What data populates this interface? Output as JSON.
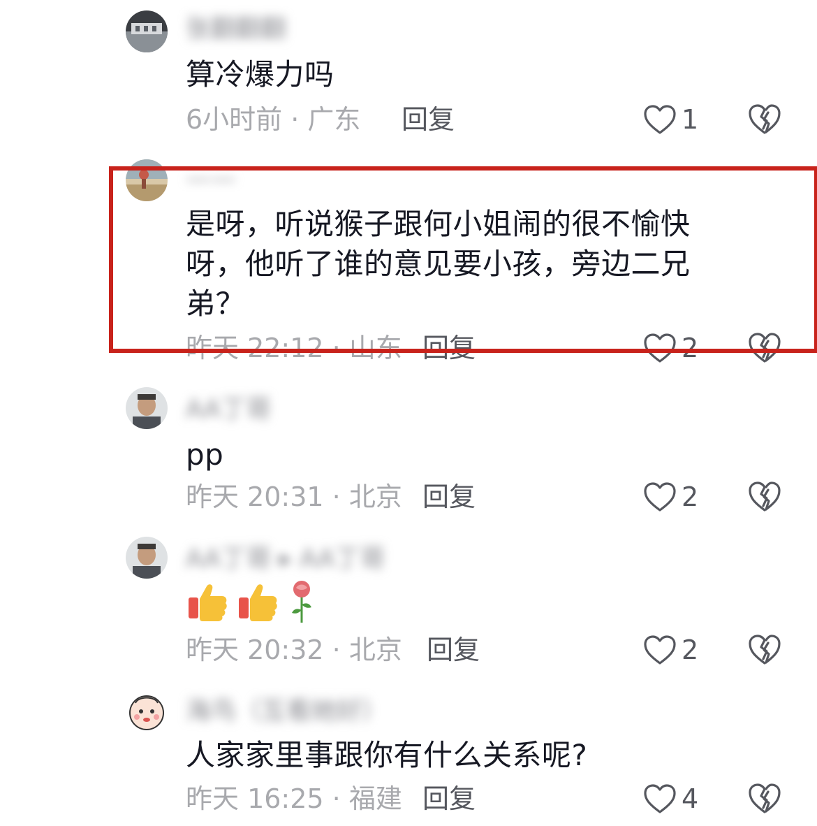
{
  "comments": [
    {
      "username": "张翻翻翻",
      "text": "算冷爆力吗",
      "meta": "6小时前 · 广东",
      "reply_label": "回复",
      "likes": "1"
    },
    {
      "username": "——",
      "text": "是呀，听说猴子跟何小姐闹的很不愉快呀，他听了谁的意见要小孩，旁边二兄弟？",
      "meta": "昨天 22:12 · 山东",
      "reply_label": "回复",
      "likes": "2"
    },
    {
      "username": "AA丁哥",
      "text": "pp",
      "meta": "昨天 20:31 · 北京",
      "reply_label": "回复",
      "likes": "2"
    },
    {
      "username": "AA丁哥 ▸ AA丁哥",
      "text": "",
      "emojis": [
        "thumbs-up",
        "thumbs-up",
        "rose"
      ],
      "meta": "昨天 20:32 · 北京",
      "reply_label": "回复",
      "likes": "2"
    },
    {
      "username": "海鸟（互看她好）",
      "text": "人家家里事跟你有什么关系呢?",
      "meta": "昨天 16:25 · 福建",
      "reply_label": "回复",
      "likes": "4"
    }
  ],
  "icons": {
    "like": "heart-outline-icon",
    "dislike": "broken-heart-icon"
  },
  "colors": {
    "highlight": "#c8221b",
    "meta_text": "#a8a9ad",
    "body_text": "#161823"
  }
}
